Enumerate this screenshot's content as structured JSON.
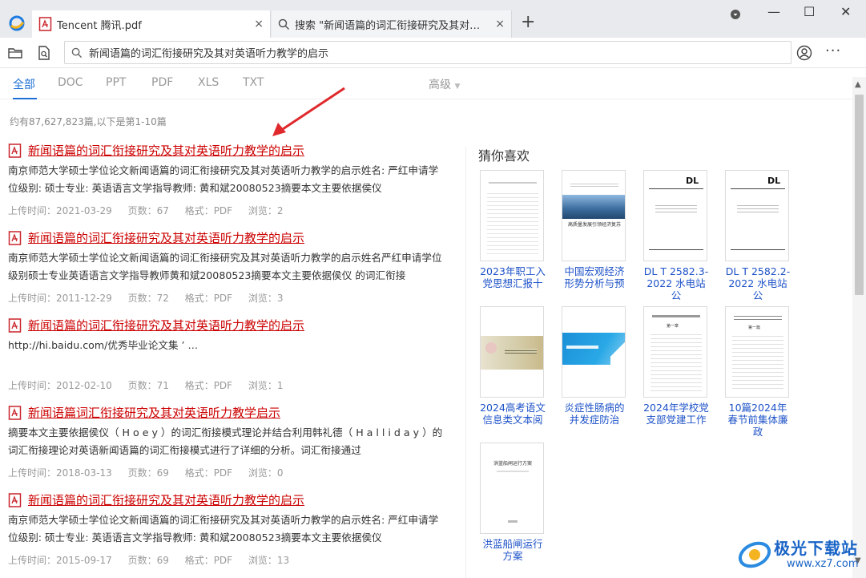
{
  "tabs": [
    {
      "title": "Tencent 腾讯.pdf",
      "close": "×"
    },
    {
      "title": "搜索 \"新闻语篇的词汇衔接研究及其对英语...",
      "close": "×"
    }
  ],
  "new_tab": "+",
  "window_controls": {
    "minimize": "—",
    "maximize": "☐",
    "close": "✕"
  },
  "search": {
    "value": "新闻语篇的词汇衔接研究及其对英语听力教学的启示"
  },
  "more": "···",
  "filters": [
    "全部",
    "DOC",
    "PPT",
    "PDF",
    "XLS",
    "TXT"
  ],
  "advanced": "高级",
  "result_count": "约有87,627,823篇,以下是第1-10篇",
  "results": [
    {
      "title": "新闻语篇的词汇衔接研究及其对英语听力教学的启示",
      "desc": "南京师范大学硕士学位论文新闻语篇的词汇衔接研究及其对英语听力教学的启示姓名: 严红申请学位级别: 硕士专业: 英语语言文学指导教师: 黄和斌20080523摘要本文主要依据侯仪",
      "upload": "上传时间：2021-03-29",
      "pages": "页数：67",
      "format": "格式：PDF",
      "views": "浏览：2"
    },
    {
      "title": "新闻语篇的词汇衔接研究及其对英语听力教学的启示",
      "desc": "南京师范大学硕士学位论文新闻语篇的词汇衔接研究及其对英语听力教学的启示姓名严红申请学位级别硕士专业英语语言文学指导教师黄和斌20080523摘要本文主要依据侯仪 的词汇衔接",
      "upload": "上传时间：2011-12-29",
      "pages": "页数：72",
      "format": "格式：PDF",
      "views": "浏览：3"
    },
    {
      "title": "新闻语篇的词汇衔接研究及其对英语听力教学的启示",
      "desc": "http://hi.baidu.com/优秀毕业论文集 ’ …",
      "upload": "上传时间：2012-02-10",
      "pages": "页数：71",
      "format": "格式：PDF",
      "views": "浏览：1"
    },
    {
      "title": "新闻语篇词汇衔接研究及其对英语听力教学启示",
      "desc": "摘要本文主要依据侯仪（ H o e y ）的词汇衔接模式理论并结合利用韩礼德（ H a l l i d a y ）的词汇衔接理论对英语新闻语篇的词汇衔接模式进行了详细的分析。词汇衔接通过",
      "upload": "上传时间：2018-03-13",
      "pages": "页数：69",
      "format": "格式：PDF",
      "views": "浏览：0"
    },
    {
      "title": "新闻语篇的词汇衔接研究及其对英语听力教学的启示",
      "desc": "南京师范大学硕士学位论文新闻语篇的词汇衔接研究及其对英语听力教学的启示姓名: 严红申请学位级别: 硕士专业: 英语语言文学指导教师: 黄和斌20080523摘要本文主要依据侯仪",
      "upload": "上传时间：2015-09-17",
      "pages": "页数：69",
      "format": "格式：PDF",
      "views": "浏览：13"
    }
  ],
  "rec_heading": "猜你喜欢",
  "recommendations": [
    {
      "title": "2023年职工入党思想汇报十",
      "thumb_text": "",
      "thumb_style": "doc"
    },
    {
      "title": "中国宏观经济形势分析与预",
      "thumb_text": "高质量发展引领经济复苏",
      "thumb_style": "city"
    },
    {
      "title": "DL T 2582.3-2022 水电站公",
      "thumb_text": "DL",
      "thumb_style": "standard"
    },
    {
      "title": "DL T 2582.2-2022 水电站公",
      "thumb_text": "DL",
      "thumb_style": "standard"
    },
    {
      "title": "2024高考语文信息类文本阅",
      "thumb_text": "",
      "thumb_style": "flower"
    },
    {
      "title": "炎症性肠病的并发症防治",
      "thumb_text": "",
      "thumb_style": "medical"
    },
    {
      "title": "2024年学校党支部党建工作",
      "thumb_text": "第一章",
      "thumb_style": "doc2"
    },
    {
      "title": "10篇2024年春节前集体廉政",
      "thumb_text": "第一篇",
      "thumb_style": "doc2"
    },
    {
      "title": "洪蓝船闸运行方案",
      "thumb_text": "洪蓝船闸运行方案",
      "thumb_style": "plain"
    }
  ],
  "watermark": {
    "main": "极光下载站",
    "sub": "www.xz7.com"
  },
  "colors": {
    "accent": "#1d6fd6",
    "result_title": "#cc0000",
    "link": "#1d52c8",
    "tab_bar": "#e9eaed"
  }
}
